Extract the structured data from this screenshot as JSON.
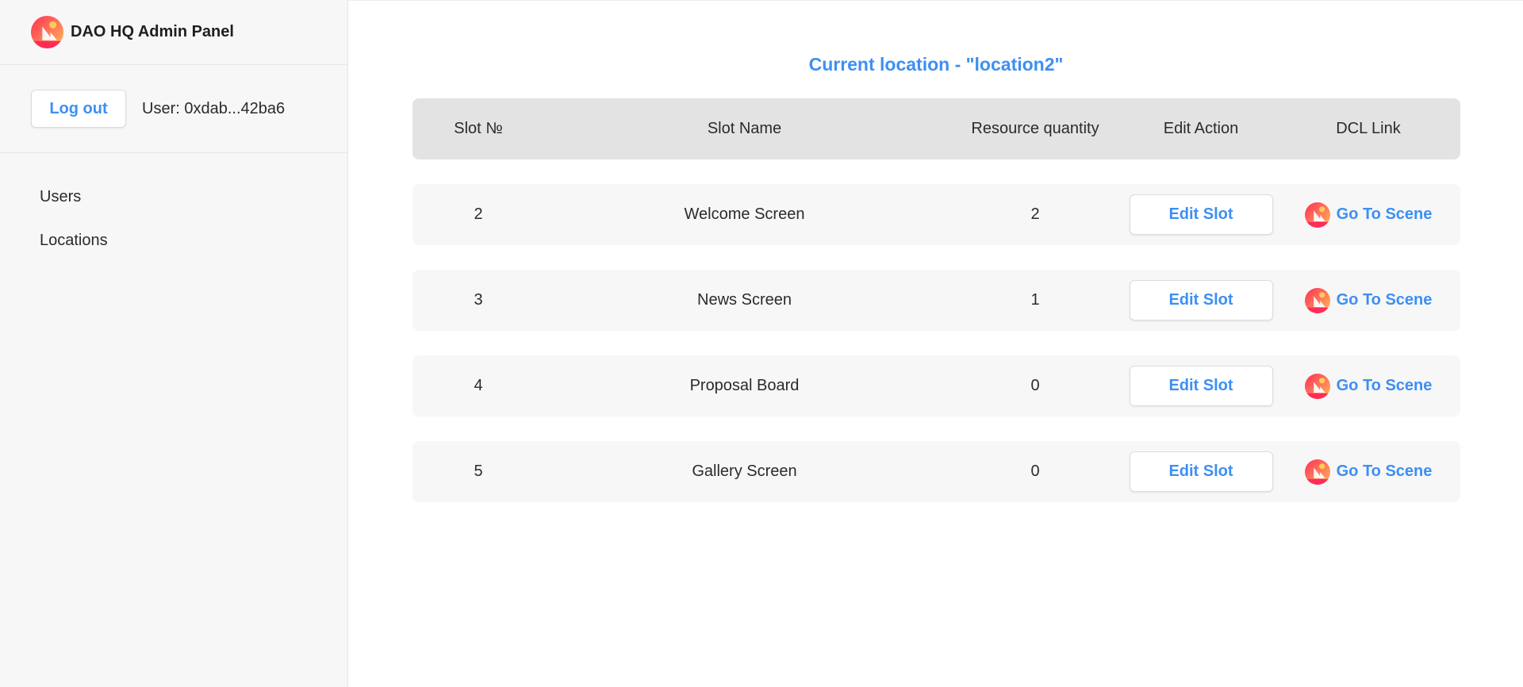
{
  "sidebar": {
    "brand_icon": "decentraland-logo-icon",
    "title": "DAO HQ Admin Panel",
    "logout_label": "Log out",
    "user_label": "User: 0xdab...42ba6",
    "nav": [
      {
        "label": "Users"
      },
      {
        "label": "Locations"
      }
    ]
  },
  "main": {
    "title": "Current location - \"location2\"",
    "table": {
      "headers": {
        "slot": "Slot №",
        "name": "Slot Name",
        "resources": "Resource quantity",
        "edit": "Edit Action",
        "link": "DCL Link"
      },
      "rows": [
        {
          "slot": "2",
          "name": "Welcome Screen",
          "resources": "2",
          "edit_label": "Edit Slot",
          "link_label": "Go To Scene",
          "link_icon": "decentraland-logo-icon"
        },
        {
          "slot": "3",
          "name": "News Screen",
          "resources": "1",
          "edit_label": "Edit Slot",
          "link_label": "Go To Scene",
          "link_icon": "decentraland-logo-icon"
        },
        {
          "slot": "4",
          "name": "Proposal Board",
          "resources": "0",
          "edit_label": "Edit Slot",
          "link_label": "Go To Scene",
          "link_icon": "decentraland-logo-icon"
        },
        {
          "slot": "5",
          "name": "Gallery Screen",
          "resources": "0",
          "edit_label": "Edit Slot",
          "link_label": "Go To Scene",
          "link_icon": "decentraland-logo-icon"
        }
      ]
    }
  },
  "colors": {
    "accent": "#3d8ff3",
    "sidebar_bg": "#f7f7f7",
    "header_bg": "#e3e3e3",
    "row_bg": "#f7f7f7"
  }
}
